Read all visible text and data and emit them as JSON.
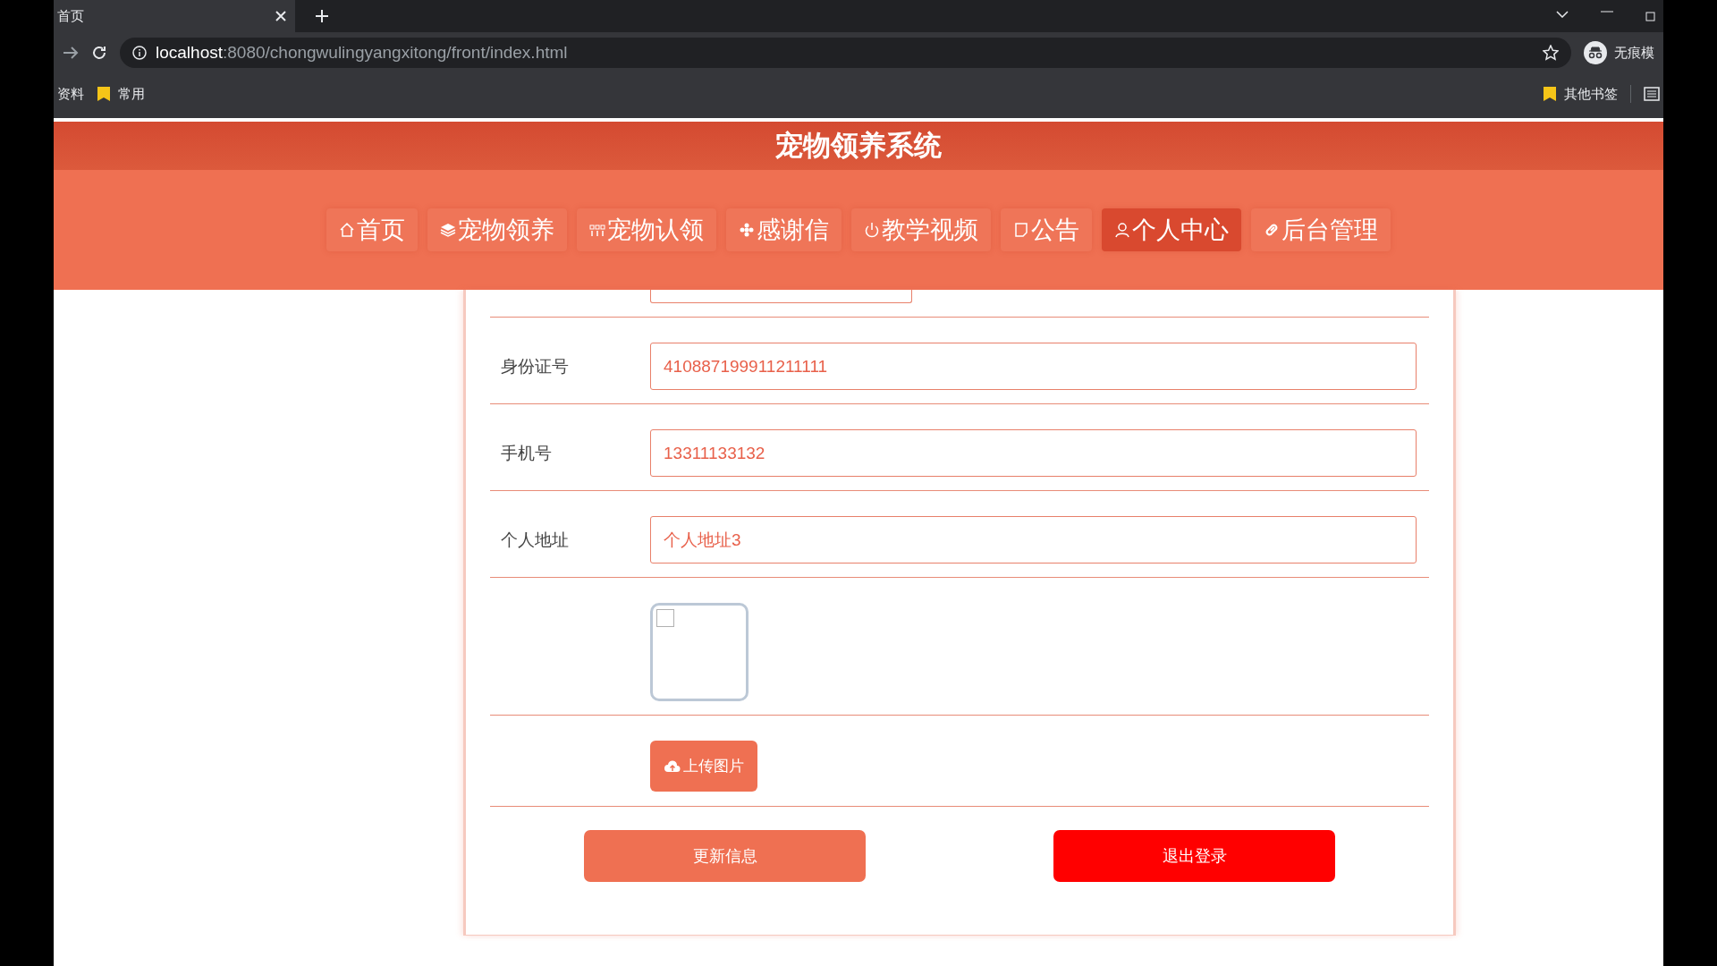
{
  "browser": {
    "tab_title": "首页",
    "url_host": "localhost",
    "url_path": ":8080/chongwulingyangxitong/front/index.html",
    "profile_label": "无痕模",
    "bookmarks_left": [
      "资料",
      "常用"
    ],
    "bookmarks_right": [
      "其他书签"
    ]
  },
  "site_title": "宠物领养系统",
  "nav": [
    {
      "label": "首页",
      "kind": "home",
      "selected": false
    },
    {
      "label": "宠物领养",
      "kind": "layers",
      "selected": false
    },
    {
      "label": "宠物认领",
      "kind": "grid",
      "selected": false
    },
    {
      "label": "感谢信",
      "kind": "flower",
      "selected": false
    },
    {
      "label": "教学视频",
      "kind": "power",
      "selected": false
    },
    {
      "label": "公告",
      "kind": "note",
      "selected": false
    },
    {
      "label": "个人中心",
      "kind": "user",
      "selected": true
    },
    {
      "label": "后台管理",
      "kind": "link",
      "selected": false
    }
  ],
  "form": {
    "fields": [
      {
        "label": "身份证号",
        "value": "410887199911211111"
      },
      {
        "label": "手机号",
        "value": "13311133132"
      },
      {
        "label": "个人地址",
        "value": "个人地址3"
      }
    ],
    "upload_button": "上传图片",
    "actions": [
      {
        "label": "更新信息",
        "kind": "update"
      },
      {
        "label": "退出登录",
        "kind": "logout"
      }
    ]
  }
}
